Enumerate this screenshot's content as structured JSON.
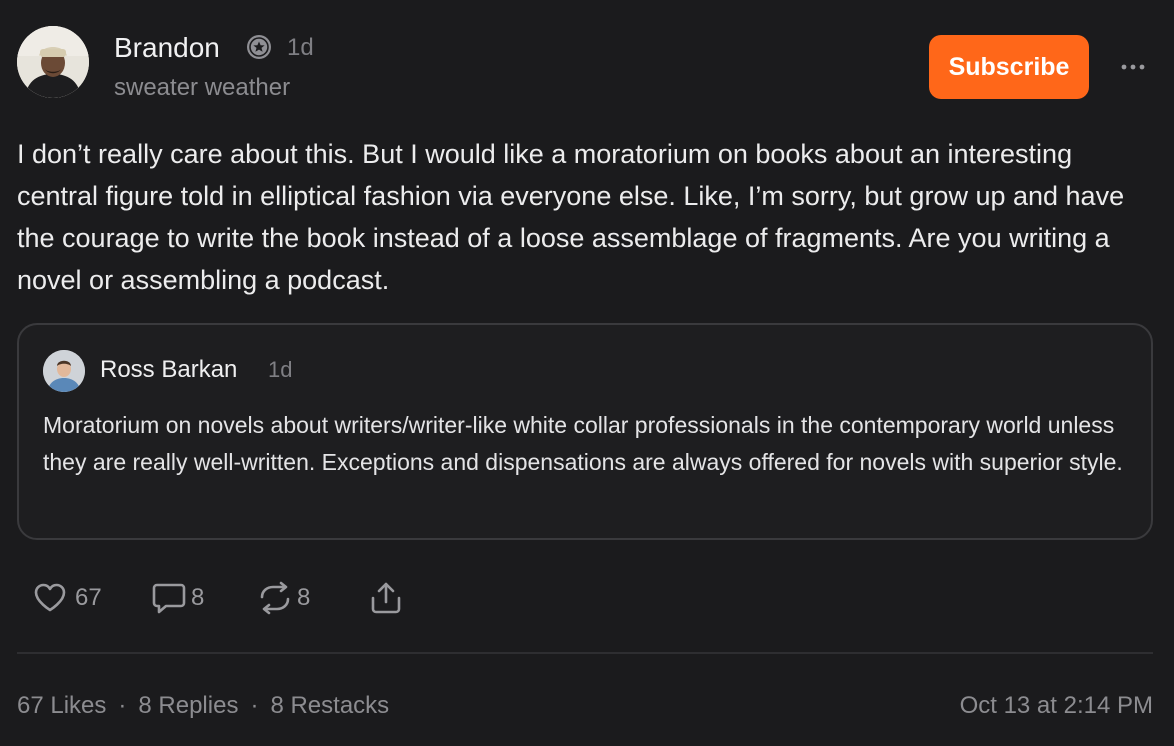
{
  "author": {
    "name": "Brandon",
    "time": "1d",
    "subtitle": "sweater weather",
    "badge_icon": "star-badge-icon",
    "avatar": "avatar-photo"
  },
  "subscribe_label": "Subscribe",
  "more_icon": "ellipsis-icon",
  "body": "I don’t really care about this. But I would like a moratorium on books about an interesting central figure told in elliptical fashion via everyone else. Like, I’m sorry, but grow up and have the courage to write the book instead of a loose assemblage of fragments. Are you writing a novel or assembling a podcast.",
  "quote": {
    "name": "Ross Barkan",
    "time": "1d",
    "text": "Moratorium on novels about writers/writer-like white collar professionals in the contemporary world unless they are really well-written. Exceptions and dispensations are always offered for novels with superior style."
  },
  "actions": {
    "likes": "67",
    "replies": "8",
    "restacks": "8",
    "icons": [
      "heart-icon",
      "comment-icon",
      "restack-icon",
      "share-icon"
    ]
  },
  "stats": {
    "likes": "67 Likes",
    "replies": "8 Replies",
    "restacks": "8 Restacks",
    "separator": "·"
  },
  "timestamp": "Oct 13 at 2:14 PM",
  "colors": {
    "background": "#1b1b1d",
    "accent": "#ff6719",
    "muted_text": "#8c8c90",
    "border": "#3a3a3d"
  }
}
